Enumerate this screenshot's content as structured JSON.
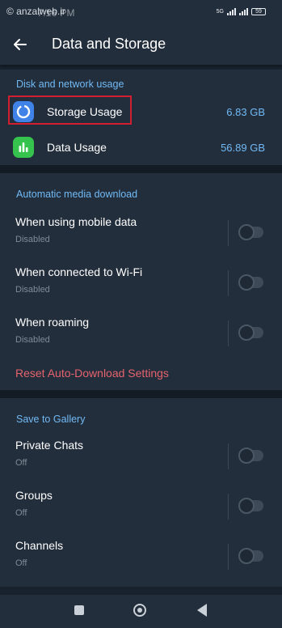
{
  "status_bar": {
    "time": "7:16 PM",
    "watermark": "© anzalweb.ir",
    "network": "5G",
    "battery": "59"
  },
  "app_bar": {
    "title": "Data and Storage",
    "back_icon": "arrow-left-icon"
  },
  "disk_section": {
    "header": "Disk and network usage",
    "items": [
      {
        "label": "Storage Usage",
        "value": "6.83 GB",
        "icon": "storage-pie-icon",
        "icon_color": "#3f83e8",
        "highlighted": true
      },
      {
        "label": "Data Usage",
        "value": "56.89 GB",
        "icon": "bar-chart-icon",
        "icon_color": "#35c24d",
        "highlighted": false
      }
    ]
  },
  "auto_download": {
    "header": "Automatic media download",
    "items": [
      {
        "label": "When using mobile data",
        "status": "Disabled",
        "enabled": false
      },
      {
        "label": "When connected to Wi-Fi",
        "status": "Disabled",
        "enabled": false
      },
      {
        "label": "When roaming",
        "status": "Disabled",
        "enabled": false
      }
    ],
    "reset_label": "Reset Auto-Download Settings"
  },
  "gallery": {
    "header": "Save to Gallery",
    "items": [
      {
        "label": "Private Chats",
        "status": "Off",
        "enabled": false
      },
      {
        "label": "Groups",
        "status": "Off",
        "enabled": false
      },
      {
        "label": "Channels",
        "status": "Off",
        "enabled": false
      }
    ]
  },
  "colors": {
    "accent": "#71baf5",
    "destructive": "#e5636d",
    "background": "#232e3c",
    "highlight_border": "#d21f30"
  }
}
